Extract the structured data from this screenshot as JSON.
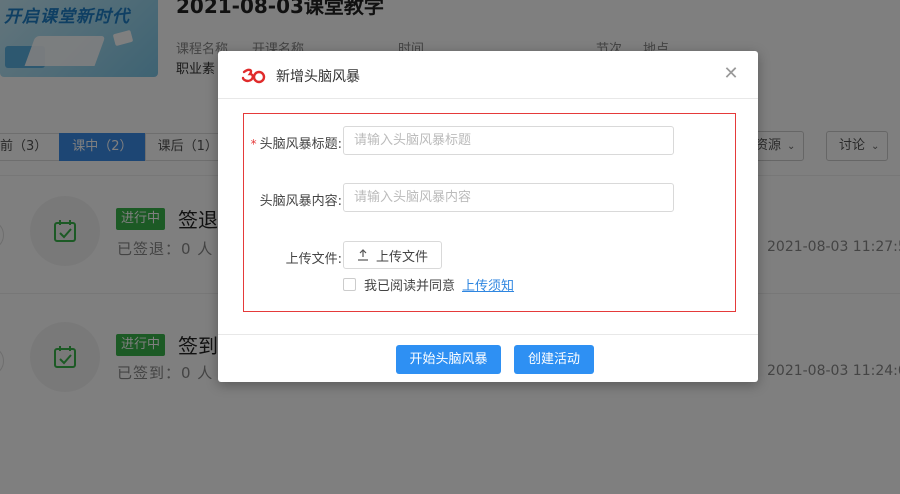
{
  "background": {
    "banner_text": "开启课堂新时代",
    "course_title": "2021-08-03课堂教学",
    "meta_labels": [
      "课程名称",
      "开课名称",
      "时间",
      "节次",
      "地点"
    ],
    "meta_values": [
      "职业素"
    ],
    "tabs": [
      {
        "label": "前（3）",
        "active": false
      },
      {
        "label": "课中（2）",
        "active": true
      },
      {
        "label": "课后（1）",
        "active": false
      }
    ],
    "tool_buttons": [
      {
        "label": "资源",
        "icon": "chevron-down-icon"
      },
      {
        "label": "讨论",
        "icon": "chevron-down-icon"
      }
    ],
    "activities": [
      {
        "badge": "进行中",
        "title": "签退",
        "sub": "已签退：0 人",
        "time": "2021-08-03 11:27:5",
        "icon": "calendar-check-icon"
      },
      {
        "badge": "进行中",
        "title": "签到",
        "sub": "已签到：0 人",
        "time": "2021-08-03 11:24:0",
        "icon": "calendar-check-icon"
      }
    ]
  },
  "modal": {
    "title": "新增头脑风暴",
    "logo_icon": "brand-logo-icon",
    "close_icon": "close-icon",
    "form": {
      "title_label": "头脑风暴标题:",
      "title_required_mark": "*",
      "title_value": "",
      "title_placeholder": "请输入头脑风暴标题",
      "content_label": "头脑风暴内容:",
      "content_value": "",
      "content_placeholder": "请输入头脑风暴内容",
      "upload_label": "上传文件:",
      "upload_button": "上传文件",
      "upload_icon": "upload-icon",
      "agree_checked": false,
      "agree_text": "我已阅读并同意",
      "agree_link": "上传须知"
    },
    "buttons": {
      "start": "开始头脑风暴",
      "create": "创建活动"
    },
    "colors": {
      "primary": "#2e90f3",
      "required": "#e53a3a",
      "badge": "#39b54a",
      "active_tab": "#3b8ce8"
    }
  }
}
